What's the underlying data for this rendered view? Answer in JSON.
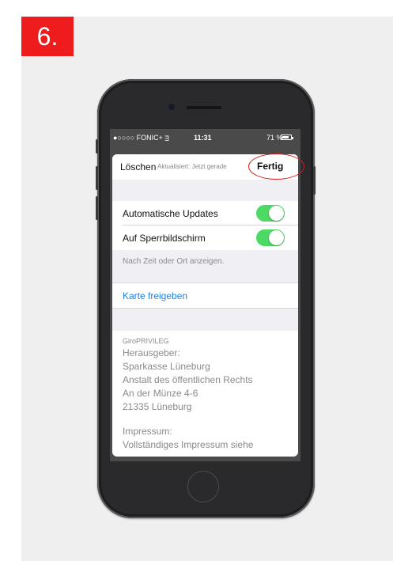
{
  "step_label": "6.",
  "status_bar": {
    "carrier": "●○○○○ FONIC+ ᴟ",
    "time": "11:31",
    "battery": "71 %"
  },
  "nav": {
    "left_label": "Löschen",
    "center_label": "Aktualisiert: Jetzt gerade",
    "right_label": "Fertig"
  },
  "settings": {
    "auto_updates_label": "Automatische Updates",
    "auto_updates_on": true,
    "lock_screen_label": "Auf Sperrbildschirm",
    "lock_screen_on": true,
    "hint": "Nach Zeit oder Ort anzeigen."
  },
  "share_link": "Karte freigeben",
  "info": {
    "card_name": "GiroPRIVILEG",
    "publisher_label": "Herausgeber:",
    "publisher_name": "Sparkasse Lüneburg",
    "publisher_type": "Anstalt des öffentlichen Rechts",
    "street": "An der Münze 4-6",
    "city": "21335 Lüneburg",
    "imprint_label": "Impressum:",
    "imprint_text": "Vollständiges Impressum siehe"
  },
  "colors": {
    "toggle_on": "#4cd964",
    "link": "#1d7fe0",
    "badge": "#ee1c1c",
    "annotation": "#d51c1c"
  }
}
